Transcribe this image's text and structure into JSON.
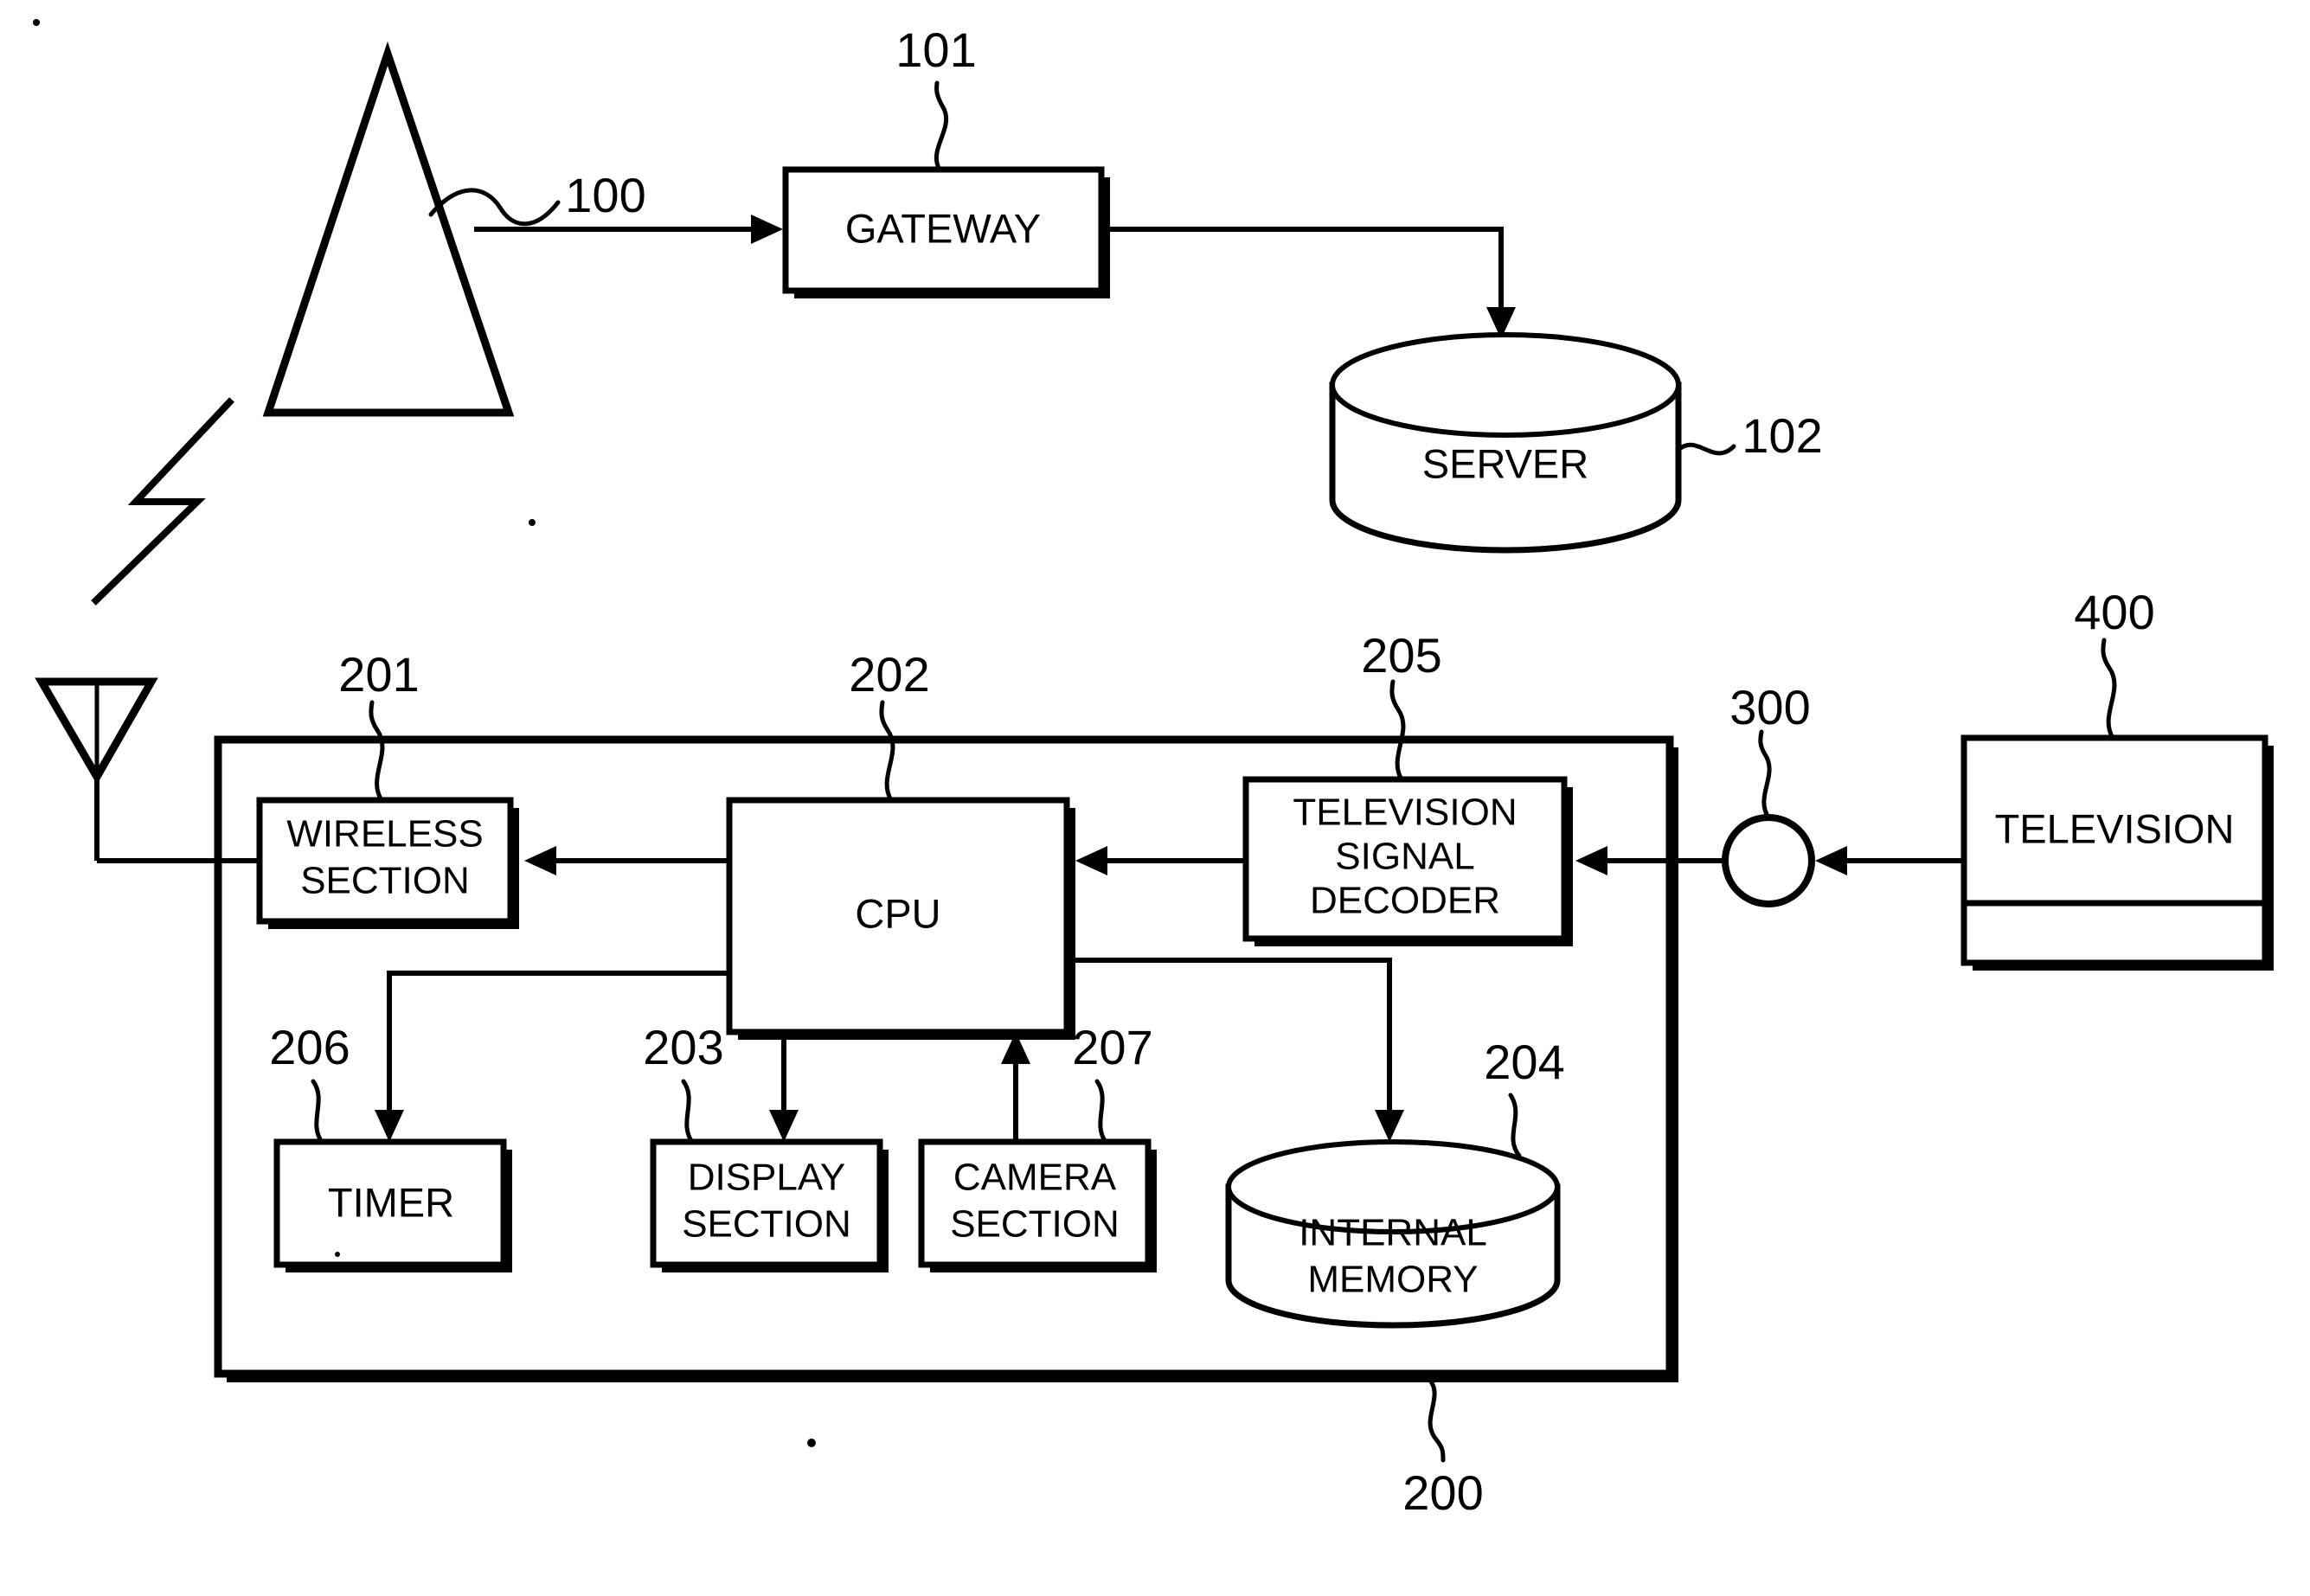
{
  "figure": {
    "type": "patent-block-diagram",
    "background": "#ffffff",
    "ink": "#000000"
  },
  "nodes": {
    "base_station": {
      "ref": "100",
      "shape": "triangle-tower",
      "label": ""
    },
    "gateway": {
      "ref": "101",
      "shape": "rectangle",
      "label": "GATEWAY"
    },
    "server": {
      "ref": "102",
      "shape": "cylinder",
      "label": "SERVER"
    },
    "terminal": {
      "ref": "200",
      "shape": "outer-rectangle",
      "label": ""
    },
    "wireless": {
      "ref": "201",
      "shape": "rectangle",
      "label_line1": "WIRELESS",
      "label_line2": "SECTION"
    },
    "cpu": {
      "ref": "202",
      "shape": "rectangle",
      "label": "CPU"
    },
    "display": {
      "ref": "203",
      "shape": "rectangle",
      "label_line1": "DISPLAY",
      "label_line2": "SECTION"
    },
    "memory": {
      "ref": "204",
      "shape": "cylinder",
      "label_line1": "INTERNAL",
      "label_line2": "MEMORY"
    },
    "tv_decoder": {
      "ref": "205",
      "shape": "rectangle",
      "label_line1": "TELEVISION",
      "label_line2": "SIGNAL",
      "label_line3": "DECODER"
    },
    "timer": {
      "ref": "206",
      "shape": "rectangle",
      "label": "TIMER"
    },
    "camera": {
      "ref": "207",
      "shape": "rectangle",
      "label_line1": "CAMERA",
      "label_line2": "SECTION"
    },
    "junction": {
      "ref": "300",
      "shape": "circle",
      "label": ""
    },
    "television": {
      "ref": "400",
      "shape": "rectangle",
      "label": "TELEVISION"
    }
  },
  "icons": {
    "base_station_antenna": "antenna-tower-icon",
    "terminal_antenna": "antenna-icon",
    "radio_link": "lightning-bolt-icon"
  },
  "connections": [
    {
      "from": "base_station",
      "to": "gateway",
      "arrow": "end"
    },
    {
      "from": "gateway",
      "to": "server",
      "arrow": "end"
    },
    {
      "from": "terminal_antenna",
      "to": "wireless",
      "arrow": "none"
    },
    {
      "from": "cpu",
      "to": "wireless",
      "arrow": "end"
    },
    {
      "from": "tv_decoder",
      "to": "cpu",
      "arrow": "end"
    },
    {
      "from": "junction",
      "to": "tv_decoder",
      "arrow": "end"
    },
    {
      "from": "television",
      "to": "junction",
      "arrow": "end"
    },
    {
      "from": "cpu",
      "to": "timer",
      "arrow": "end"
    },
    {
      "from": "cpu",
      "to": "display",
      "arrow": "end"
    },
    {
      "from": "camera",
      "to": "cpu",
      "arrow": "end"
    },
    {
      "from": "cpu",
      "to": "memory",
      "arrow": "end"
    }
  ]
}
